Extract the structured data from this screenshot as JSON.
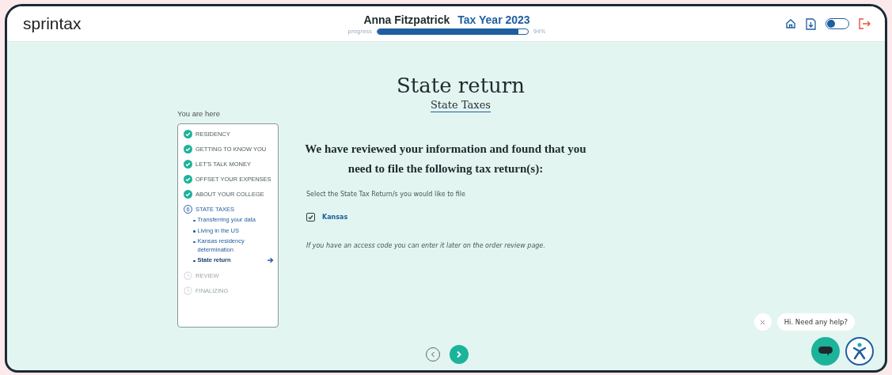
{
  "header": {
    "logo": "sprintax",
    "user_name": "Anna Fitzpatrick",
    "tax_year": "Tax Year 2023",
    "progress_label": "progress",
    "progress": {
      "level": 0.94
    },
    "progress_reading": "94%",
    "theme_toggle": {
      "on": false
    }
  },
  "sidebar": {
    "title": "You are here",
    "steps": [
      {
        "label": "RESIDENCY",
        "completed": true,
        "current": false
      },
      {
        "label": "GETTING TO KNOW YOU",
        "completed": true,
        "current": false
      },
      {
        "label": "LET'S TALK MONEY",
        "completed": true,
        "current": false
      },
      {
        "label": "OFFSET YOUR EXPENSES",
        "completed": true,
        "current": false
      },
      {
        "label": "ABOUT YOUR COLLEGE",
        "completed": true,
        "current": false
      },
      {
        "label": "STATE TAXES",
        "completed": false,
        "current": true,
        "marker": "6",
        "children": [
          {
            "label": "Transferring your data",
            "selected": false
          },
          {
            "label": "Living in the US",
            "selected": false
          },
          {
            "label": "Kansas residency determination",
            "selected": false
          },
          {
            "label": "State return",
            "selected": true
          }
        ]
      },
      {
        "label": "REVIEW",
        "completed": false,
        "current": false
      },
      {
        "label": "FINALIZING",
        "completed": false,
        "current": false
      }
    ]
  },
  "main": {
    "title": "State return",
    "subtitle": "State Taxes",
    "heading": "We have reviewed your information and found that you need to file the following tax return(s):",
    "instruction": "Select the State Tax Return/s you would like to file",
    "options": [
      {
        "label": "Kansas",
        "checked": true
      }
    ],
    "note": "If you have an access code you can enter it later on the order review page."
  },
  "chat": {
    "message": "Hi. Need any help?"
  }
}
